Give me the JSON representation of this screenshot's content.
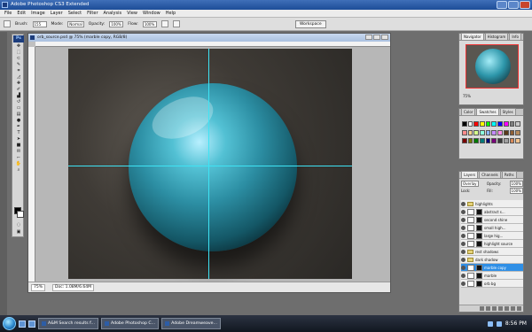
{
  "app": {
    "title": "Adobe Photoshop CS3 Extended"
  },
  "menu": {
    "items": [
      "File",
      "Edit",
      "Image",
      "Layer",
      "Select",
      "Filter",
      "Analysis",
      "View",
      "Window",
      "Help"
    ]
  },
  "options_bar": {
    "brush_label": "Brush:",
    "brush_value": "155",
    "mode_label": "Mode:",
    "mode_value": "Normal",
    "opacity_label": "Opacity:",
    "opacity_value": "100%",
    "flow_label": "Flow:",
    "flow_value": "100%",
    "workspace_label": "Workspace"
  },
  "toolbox": {
    "logo": "Ps",
    "tools": [
      "move",
      "marquee",
      "lasso",
      "quick-selection",
      "crop",
      "slice",
      "healing",
      "brush",
      "clone",
      "history-brush",
      "eraser",
      "gradient",
      "dodge",
      "pen",
      "type",
      "path-selection",
      "shape",
      "notes",
      "eyedropper",
      "hand",
      "zoom"
    ]
  },
  "document": {
    "title": "orb_source.psd @ 75% (marble copy, RGB/8)",
    "zoom": "75%",
    "doc_info": "Doc: 1.08M/6.64M"
  },
  "navigator": {
    "tabs": [
      "Navigator",
      "Histogram",
      "Info"
    ],
    "zoom_value": "75%"
  },
  "color_panel": {
    "tabs": [
      "Color",
      "Swatches",
      "Styles"
    ],
    "swatches": [
      "#000000",
      "#ffffff",
      "#ff0000",
      "#ffff00",
      "#00ff00",
      "#00ffff",
      "#0000ff",
      "#ff00ff",
      "#7f7f7f",
      "#c8c8c8",
      "#ff8c8c",
      "#ffd38c",
      "#d6ff8c",
      "#8cffde",
      "#8cb8ff",
      "#c48cff",
      "#ff8ce5",
      "#5a3a1a",
      "#905f35",
      "#b68b5d",
      "#7a0000",
      "#7a7a00",
      "#007a00",
      "#007a7a",
      "#00007a",
      "#7a007a",
      "#3a3a3a",
      "#a0a0a0",
      "#d88a5a",
      "#f2c38f"
    ]
  },
  "layers_panel": {
    "tabs": [
      "Layers",
      "Channels",
      "Paths"
    ],
    "blend_mode": "Overlay",
    "opacity_label": "Opacity:",
    "opacity_value": "100%",
    "lock_label": "Lock:",
    "fill_label": "Fill:",
    "fill_value": "100%",
    "layers": [
      {
        "name": "highlights",
        "type": "group",
        "selected": false
      },
      {
        "name": "abstract s...",
        "type": "layer",
        "selected": false
      },
      {
        "name": "second shine",
        "type": "layer",
        "selected": false
      },
      {
        "name": "small high...",
        "type": "layer",
        "selected": false
      },
      {
        "name": "large hig...",
        "type": "layer",
        "selected": false
      },
      {
        "name": "highlight source",
        "type": "layer",
        "selected": false
      },
      {
        "name": "rest shadows",
        "type": "group",
        "selected": false
      },
      {
        "name": "dark shadow",
        "type": "group",
        "selected": false
      },
      {
        "name": "marble copy",
        "type": "layer",
        "selected": true
      },
      {
        "name": "marble",
        "type": "layer",
        "selected": false
      },
      {
        "name": "orb bg",
        "type": "layer",
        "selected": false
      }
    ]
  },
  "taskbar": {
    "items": [
      "A&M Search results f...",
      "Adobe Photoshop C...",
      "Adobe Dreamweave..."
    ],
    "time": "8:56 PM"
  }
}
